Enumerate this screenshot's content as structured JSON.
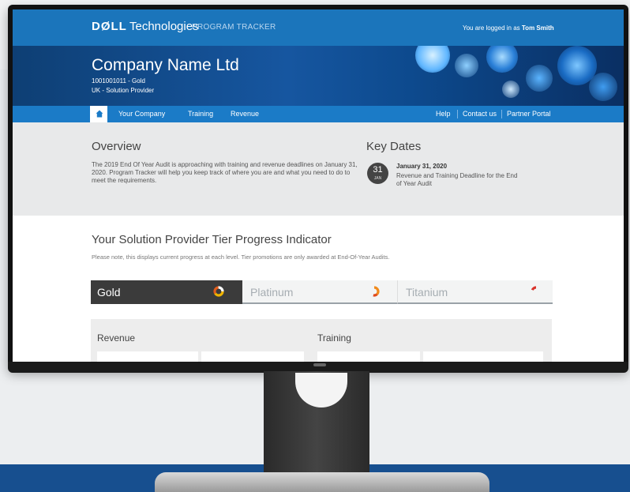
{
  "header": {
    "brand_dell": "DØLL",
    "brand_tech": "Technologies",
    "brand_product": "PROGRAM TRACKER",
    "login_prefix": "You are logged in as",
    "login_user": "Tom Smith"
  },
  "hero": {
    "company": "Company Name Ltd",
    "account": "1001001011 - Gold",
    "region": "UK - Solution Provider"
  },
  "nav": {
    "home_icon": "home-icon",
    "left_items": [
      "Your Company",
      "Training",
      "Revenue"
    ],
    "right_items": [
      "Help",
      "Contact us",
      "Partner Portal"
    ]
  },
  "overview": {
    "title": "Overview",
    "text": "The 2019 End Of Year Audit is approaching with training and revenue deadlines on January 31, 2020. Program Tracker will help you keep track of where you are and what you need to do to meet the requirements."
  },
  "key_dates": {
    "title": "Key Dates",
    "day": "31",
    "month": "JAN",
    "date": "January 31, 2020",
    "description": "Revenue and Training Deadline for the End of Year Audit"
  },
  "tier_progress": {
    "title": "Your Solution Provider Tier Progress Indicator",
    "note": "Please note, this displays current progress at each level. Tier promotions are only awarded at End-Of-Year Audits.",
    "tiers": [
      {
        "label": "Gold",
        "active": true
      },
      {
        "label": "Platinum",
        "active": false
      },
      {
        "label": "Titanium",
        "active": false
      }
    ]
  },
  "metrics": {
    "revenue_label": "Revenue",
    "training_label": "Training"
  },
  "colors": {
    "topbar": "#1b75bb",
    "nav": "#1b7bc7",
    "hero": "#0e3f74",
    "page_bottom": "#174f8f",
    "active_tier": "#3b3b3b"
  }
}
